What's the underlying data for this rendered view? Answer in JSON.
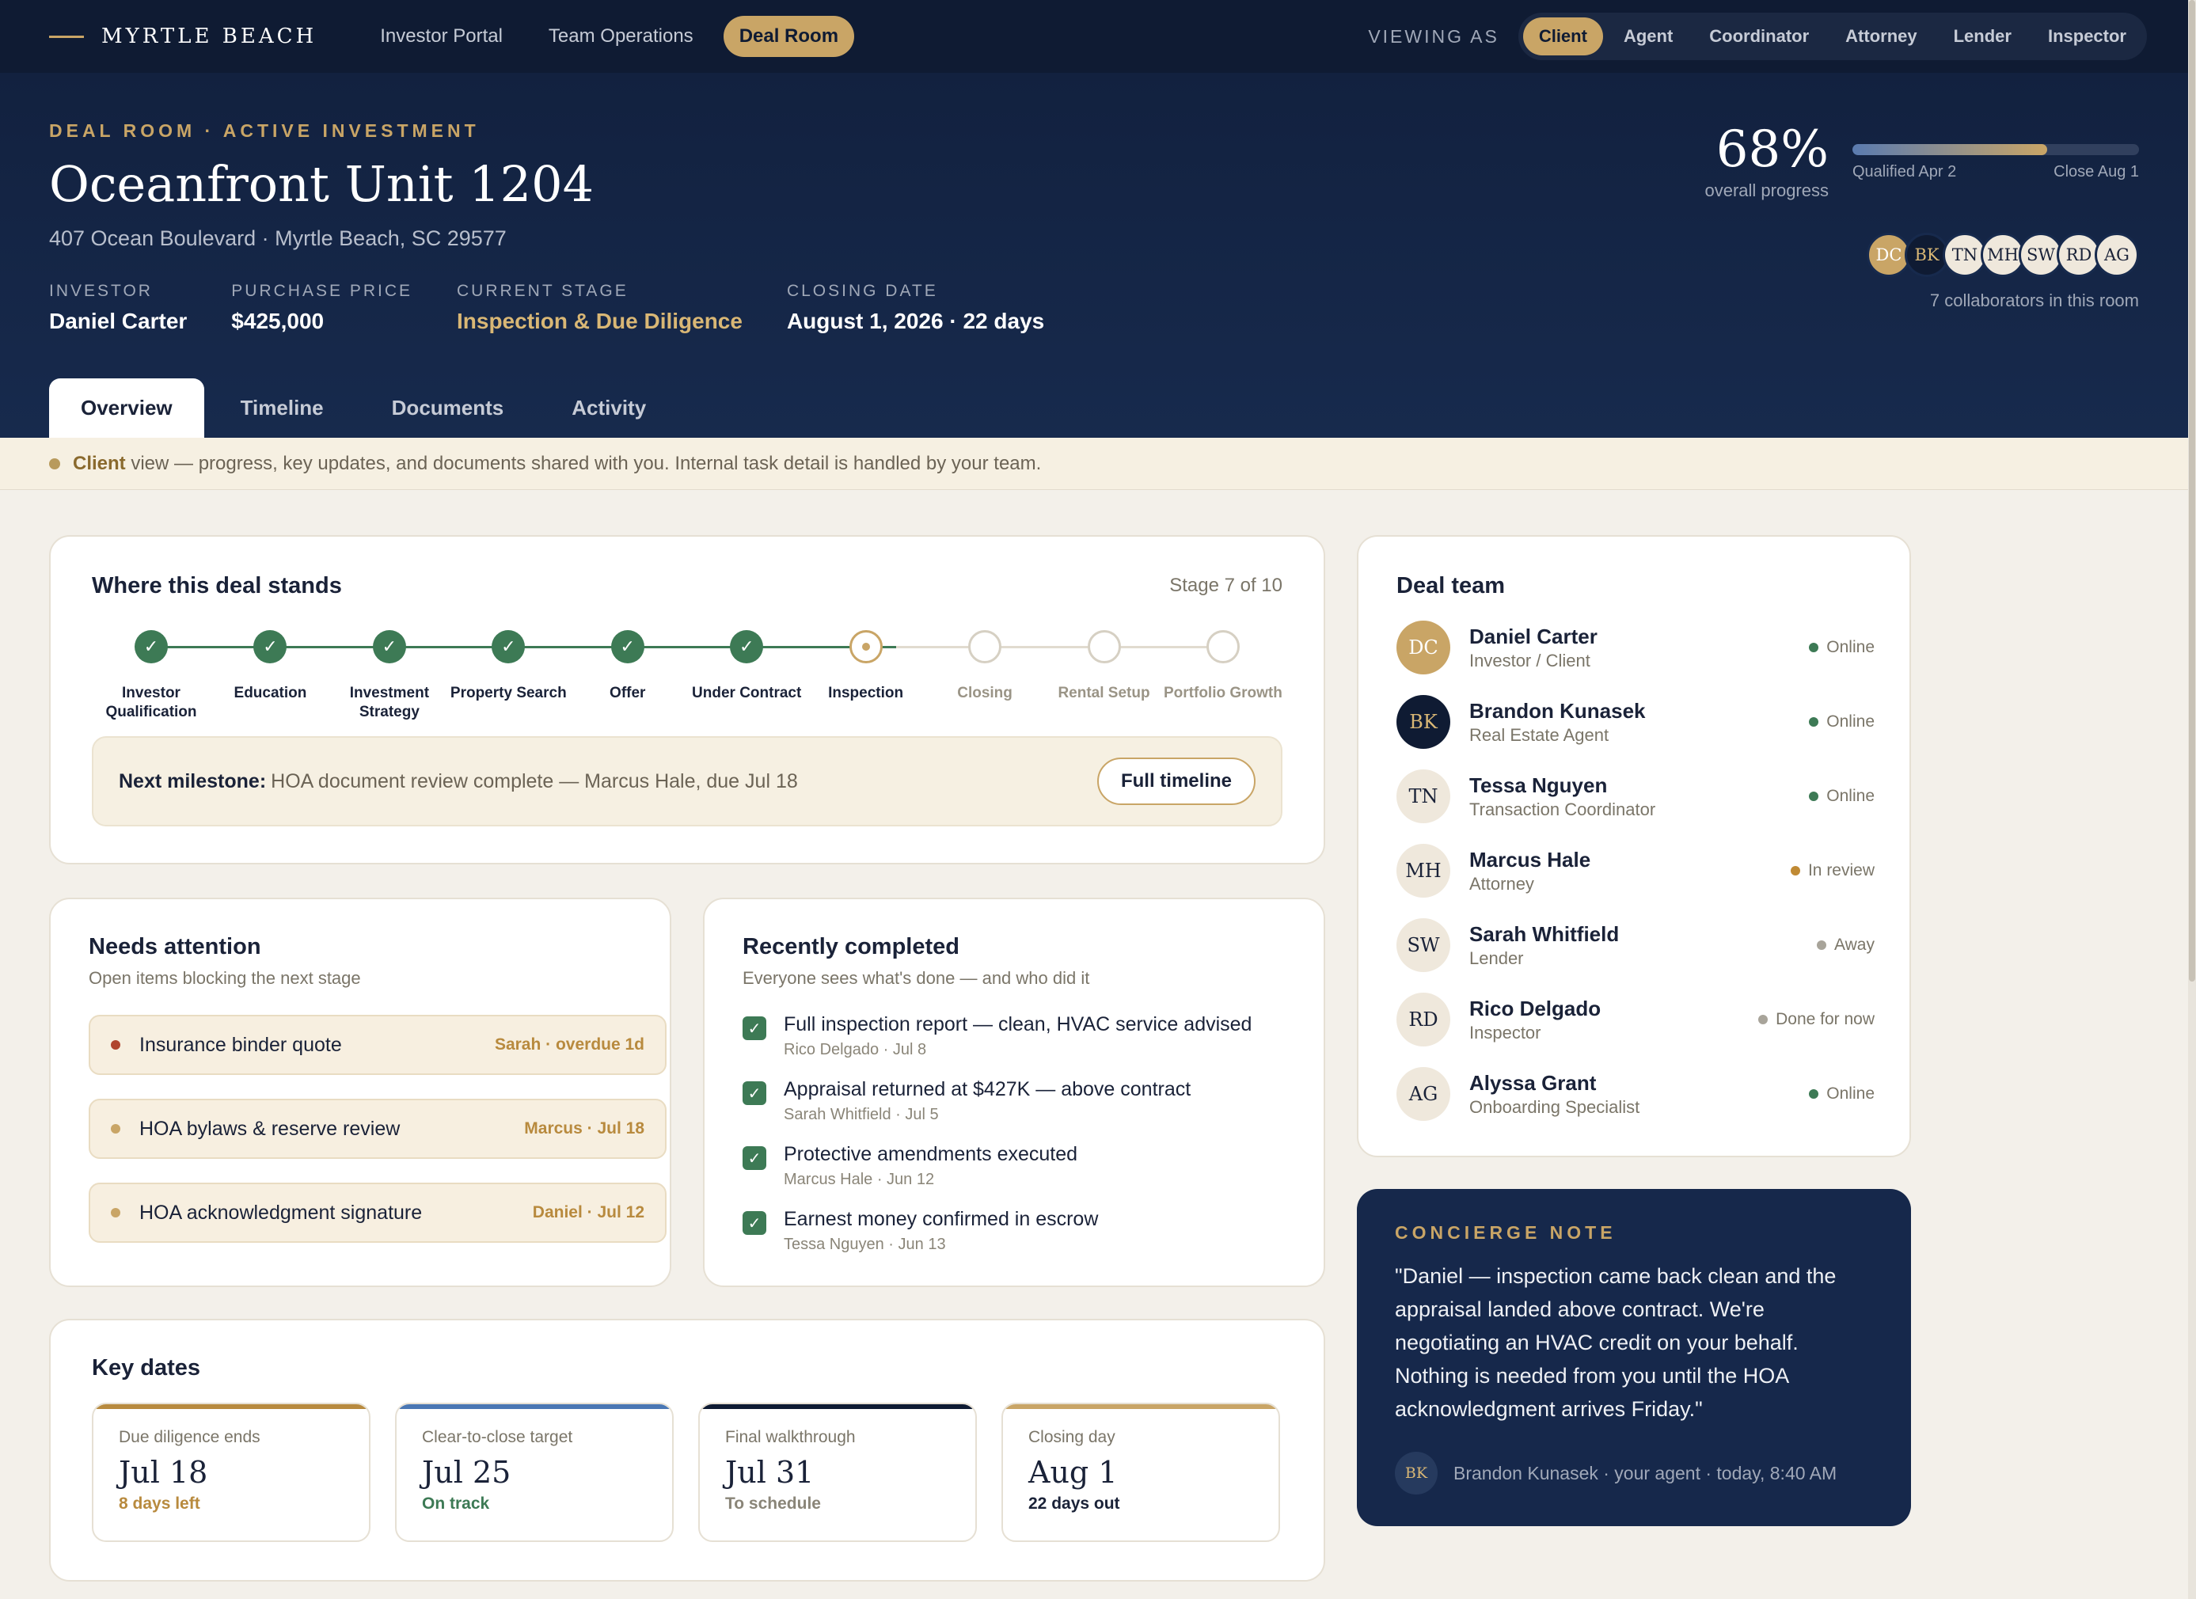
{
  "brand": "MYRTLE BEACH",
  "nav": [
    "Investor Portal",
    "Team Operations",
    "Deal Room"
  ],
  "nav_active": 2,
  "viewing_as_label": "VIEWING AS",
  "roles": [
    "Client",
    "Agent",
    "Coordinator",
    "Attorney",
    "Lender",
    "Inspector"
  ],
  "role_active": 0,
  "hero": {
    "eyebrow": "DEAL ROOM · ACTIVE INVESTMENT",
    "title": "Oceanfront Unit 1204",
    "address": "407 Ocean Boulevard · Myrtle Beach, SC 29577",
    "facts": [
      {
        "label": "INVESTOR",
        "value": "Daniel Carter",
        "gold": false
      },
      {
        "label": "PURCHASE PRICE",
        "value": "$425,000",
        "gold": false
      },
      {
        "label": "CURRENT STAGE",
        "value": "Inspection & Due Diligence",
        "gold": true
      },
      {
        "label": "CLOSING DATE",
        "value": "August 1, 2026 · 22 days",
        "gold": false
      }
    ],
    "progress_pct": "68%",
    "progress_value": 0.68,
    "progress_sub": "overall progress",
    "progress_start": "Qualified Apr 2",
    "progress_end": "Close Aug 1",
    "collaborators": [
      "DC",
      "BK",
      "TN",
      "MH",
      "SW",
      "RD",
      "AG"
    ],
    "collaborators_text": "7 collaborators in this room"
  },
  "tabs": [
    "Overview",
    "Timeline",
    "Documents",
    "Activity"
  ],
  "tab_active": 0,
  "notice": {
    "role": "Client",
    "text": "view — progress, key updates, and documents shared with you. Internal task detail is handled by your team."
  },
  "stands": {
    "title": "Where this deal stands",
    "stage": "Stage 7 of 10",
    "steps": [
      {
        "label": "Investor Qualification",
        "state": "done"
      },
      {
        "label": "Education",
        "state": "done"
      },
      {
        "label": "Investment Strategy",
        "state": "done"
      },
      {
        "label": "Property Search",
        "state": "done"
      },
      {
        "label": "Offer",
        "state": "done"
      },
      {
        "label": "Under Contract",
        "state": "done"
      },
      {
        "label": "Inspection",
        "state": "current"
      },
      {
        "label": "Closing",
        "state": "todo"
      },
      {
        "label": "Rental Setup",
        "state": "todo"
      },
      {
        "label": "Portfolio Growth",
        "state": "todo"
      }
    ],
    "milestone_label": "Next milestone:",
    "milestone_text": "HOA document review complete — Marcus Hale, due Jul 18",
    "timeline_button": "Full timeline"
  },
  "attention": {
    "title": "Needs attention",
    "subtitle": "Open items blocking the next stage",
    "items": [
      {
        "text": "Insurance binder quote",
        "meta": "Sarah · overdue 1d",
        "color": "#b0452e"
      },
      {
        "text": "HOA bylaws & reserve review",
        "meta": "Marcus · Jul 18",
        "color": "#c9a566"
      },
      {
        "text": "HOA acknowledgment signature",
        "meta": "Daniel · Jul 12",
        "color": "#c9a566"
      }
    ]
  },
  "completed": {
    "title": "Recently completed",
    "subtitle": "Everyone sees what's done — and who did it",
    "items": [
      {
        "text": "Full inspection report — clean, HVAC service advised",
        "meta": "Rico Delgado · Jul 8"
      },
      {
        "text": "Appraisal returned at $427K — above contract",
        "meta": "Sarah Whitfield · Jul 5"
      },
      {
        "text": "Protective amendments executed",
        "meta": "Marcus Hale · Jun 12"
      },
      {
        "text": "Earnest money confirmed in escrow",
        "meta": "Tessa Nguyen · Jun 13"
      }
    ]
  },
  "key_dates": {
    "title": "Key dates",
    "items": [
      {
        "label": "Due diligence ends",
        "date": "Jul 18",
        "note": "8 days left",
        "accent": "#b88a3e",
        "note_color": "#b88a3e"
      },
      {
        "label": "Clear-to-close target",
        "date": "Jul 25",
        "note": "On track",
        "accent": "#4a77b4",
        "note_color": "#3d7a55"
      },
      {
        "label": "Final walkthrough",
        "date": "Jul 31",
        "note": "To schedule",
        "accent": "#0f1b33",
        "note_color": "#8a8578"
      },
      {
        "label": "Closing day",
        "date": "Aug 1",
        "note": "22 days out",
        "accent": "#c9a566",
        "note_color": "#1a2238"
      }
    ]
  },
  "team": {
    "title": "Deal team",
    "members": [
      {
        "initials": "DC",
        "name": "Daniel Carter",
        "role": "Investor / Client",
        "status": "Online",
        "status_color": "#3d7a55",
        "style": "gold"
      },
      {
        "initials": "BK",
        "name": "Brandon Kunasek",
        "role": "Real Estate Agent",
        "status": "Online",
        "status_color": "#3d7a55",
        "style": "navy"
      },
      {
        "initials": "TN",
        "name": "Tessa Nguyen",
        "role": "Transaction Coordinator",
        "status": "Online",
        "status_color": "#3d7a55",
        "style": "light"
      },
      {
        "initials": "MH",
        "name": "Marcus Hale",
        "role": "Attorney",
        "status": "In review",
        "status_color": "#c08a34",
        "style": "light"
      },
      {
        "initials": "SW",
        "name": "Sarah Whitfield",
        "role": "Lender",
        "status": "Away",
        "status_color": "#a8a49a",
        "style": "light"
      },
      {
        "initials": "RD",
        "name": "Rico Delgado",
        "role": "Inspector",
        "status": "Done for now",
        "status_color": "#a8a49a",
        "style": "light"
      },
      {
        "initials": "AG",
        "name": "Alyssa Grant",
        "role": "Onboarding Specialist",
        "status": "Online",
        "status_color": "#3d7a55",
        "style": "light"
      }
    ]
  },
  "concierge": {
    "eyebrow": "CONCIERGE NOTE",
    "quote": "\"Daniel — inspection came back clean and the appraisal landed above contract. We're negotiating an HVAC credit on your behalf. Nothing is needed from you until the HOA acknowledgment arrives Friday.\"",
    "author_initials": "BK",
    "author": "Brandon Kunasek · your agent · today, 8:40 AM"
  },
  "colors": {
    "navy": "#0f1b33",
    "gold": "#c9a566",
    "green": "#3d7a55",
    "cream": "#f3f0ea"
  }
}
